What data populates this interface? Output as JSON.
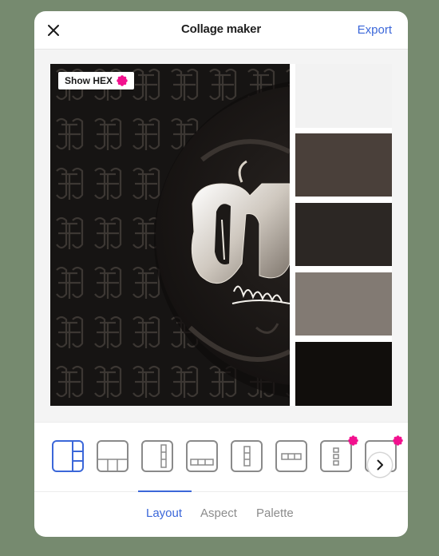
{
  "header": {
    "title": "Collage maker",
    "export_label": "Export",
    "close_icon": "close-icon"
  },
  "canvas": {
    "show_hex_label": "Show HEX",
    "photo": "dark monogram logo artwork",
    "palette_swatches": [
      "#f2f2f2",
      "#4a403a",
      "#2c2724",
      "#827a73",
      "#110e0c"
    ]
  },
  "layouts": {
    "options": [
      "two-column-split",
      "top-and-triple-bottom",
      "single-with-column",
      "top-with-row",
      "column-of-three",
      "row-of-three",
      "column-of-three-small",
      "row-tall"
    ],
    "selected_index": 0,
    "premium_indices": [
      6,
      7
    ],
    "next_icon": "chevron-right-icon"
  },
  "tabs": [
    {
      "label": "Layout",
      "active": true
    },
    {
      "label": "Aspect",
      "active": false
    },
    {
      "label": "Palette",
      "active": false
    }
  ],
  "colors": {
    "accent": "#3b67d9",
    "premium_badge": "#f2108e",
    "background": "#768a6f"
  }
}
